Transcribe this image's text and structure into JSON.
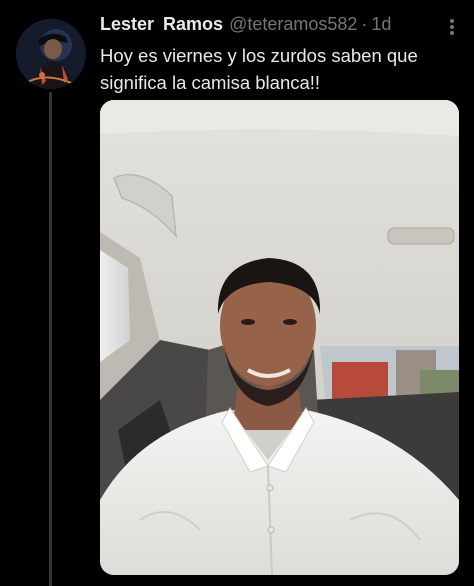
{
  "tweet": {
    "display_name": "Lester  Ramos",
    "handle": "@teteramos582",
    "separator": "·",
    "time": "1d",
    "text": "Hoy es viernes y los zurdos saben que significa la camisa blanca!!"
  },
  "icons": {
    "avatar": "avatar-image",
    "more": "more-options-icon"
  },
  "colors": {
    "background": "#000000",
    "primary_text": "#e7e9ea",
    "secondary_text": "#71767b",
    "thread_line": "#333639"
  }
}
